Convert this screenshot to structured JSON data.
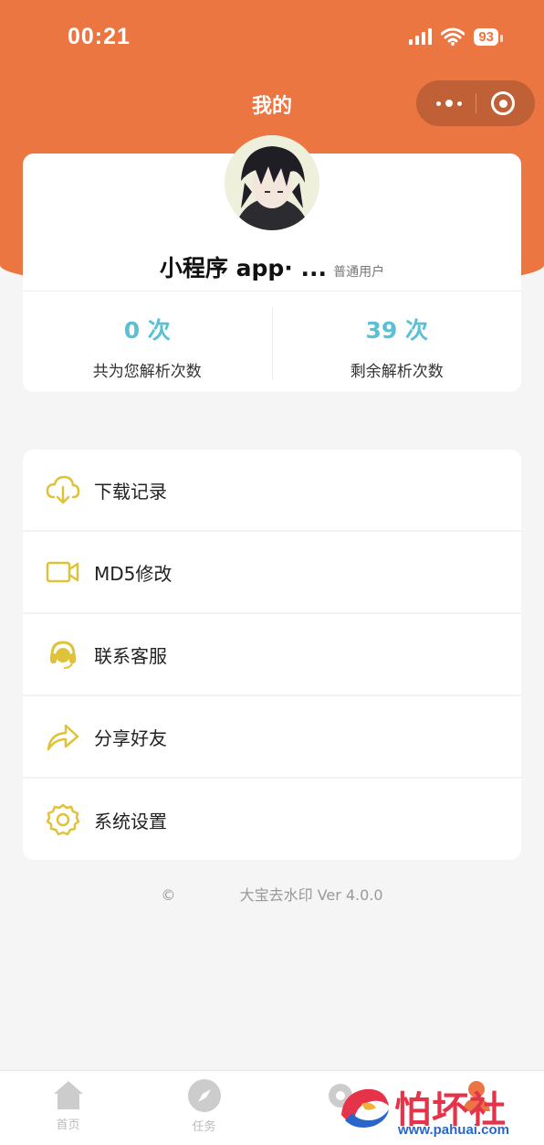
{
  "status_bar": {
    "time": "00:21",
    "battery": "93"
  },
  "nav": {
    "title": "我的"
  },
  "profile": {
    "username": "小程序 app· ...",
    "user_type": "普通用户",
    "stats": [
      {
        "value": "0 次",
        "label": "共为您解析次数"
      },
      {
        "value": "39 次",
        "label": "剩余解析次数"
      }
    ]
  },
  "menu": {
    "items": [
      {
        "label": "下载记录",
        "icon": "cloud-download-icon"
      },
      {
        "label": "MD5修改",
        "icon": "video-camera-icon"
      },
      {
        "label": "联系客服",
        "icon": "headset-icon"
      },
      {
        "label": "分享好友",
        "icon": "share-arrow-icon"
      },
      {
        "label": "系统设置",
        "icon": "gear-icon"
      }
    ]
  },
  "footer": {
    "copyright_symbol": "©",
    "text": "大宝去水印 Ver 4.0.0"
  },
  "tabbar": {
    "tabs": [
      {
        "label": "首页",
        "icon": "home-icon"
      },
      {
        "label": "任务",
        "icon": "compass-icon"
      },
      {
        "label": "",
        "icon": "gear-icon"
      },
      {
        "label": "",
        "icon": "user-icon"
      }
    ]
  },
  "watermark": {
    "name": "怕坏社区",
    "url": "www.pahuai.com"
  },
  "colors": {
    "header": "#ec7642",
    "accent_value": "#5bbfd6",
    "icon_yellow": "#e0c23a"
  }
}
